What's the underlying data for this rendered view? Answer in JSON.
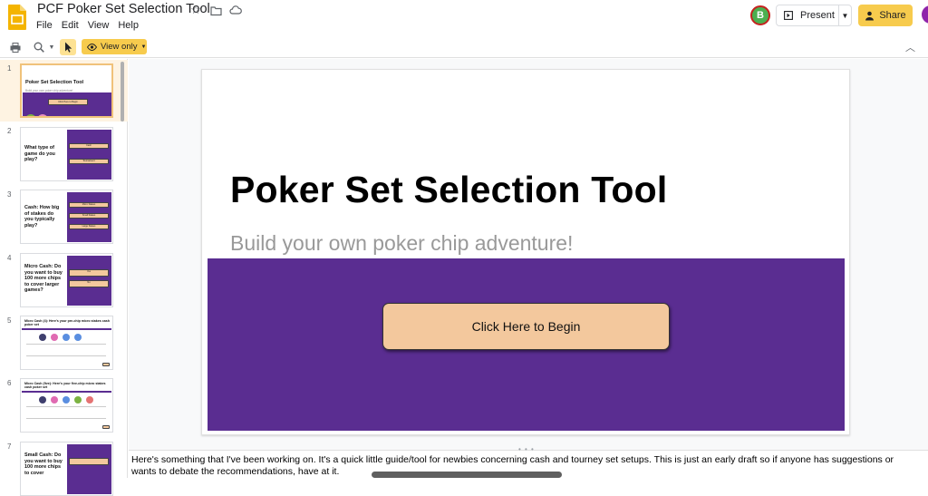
{
  "header": {
    "doc_title": "PCF Poker Set Selection Tool",
    "menu": [
      "File",
      "Edit",
      "View",
      "Help"
    ],
    "avatar_initial": "B",
    "present_label": "Present",
    "share_label": "Share"
  },
  "toolbar": {
    "view_mode_label": "View only"
  },
  "filmstrip": {
    "slides": [
      {
        "num": "1",
        "title": "Poker Set Selection Tool",
        "subtitle": "Build your own poker chip adventure!",
        "button": "Click Here to Begin"
      },
      {
        "num": "2",
        "title": "What type of game do you play?",
        "buttons": [
          "Cash",
          "Tournament"
        ]
      },
      {
        "num": "3",
        "title": "Cash: How big of stakes do you typically play?",
        "buttons": [
          "Micro Stakes",
          "Small Stakes",
          "Large Stakes"
        ]
      },
      {
        "num": "4",
        "title": "Micro Cash: Do you want to buy 100 more chips to cover larger games?",
        "buttons": [
          "Yes",
          "No"
        ]
      },
      {
        "num": "5",
        "title": "Micro Cash (4): Here's your pre-chip micro stakes cash poker set"
      },
      {
        "num": "6",
        "title": "Micro Cash (five): Here's your five-chip micro stakes cash poker set"
      },
      {
        "num": "7",
        "title": "Small Cash: Do you want to buy 100 more chips to cover"
      }
    ]
  },
  "slide": {
    "title": "Poker Set Selection Tool",
    "subtitle": "Build your own poker chip adventure!",
    "begin_button": "Click Here to Begin"
  },
  "notes": {
    "text": "Here's something that I've been working on. It's a quick little guide/tool for newbies concerning cash and tourney set setups. This is just an early draft so if anyone has suggestions or wants to debate the recommendations, have at it."
  },
  "colors": {
    "accent_yellow": "#f7cb4d",
    "slide_purple": "#5a2d91",
    "button_peach": "#f3c89d"
  }
}
